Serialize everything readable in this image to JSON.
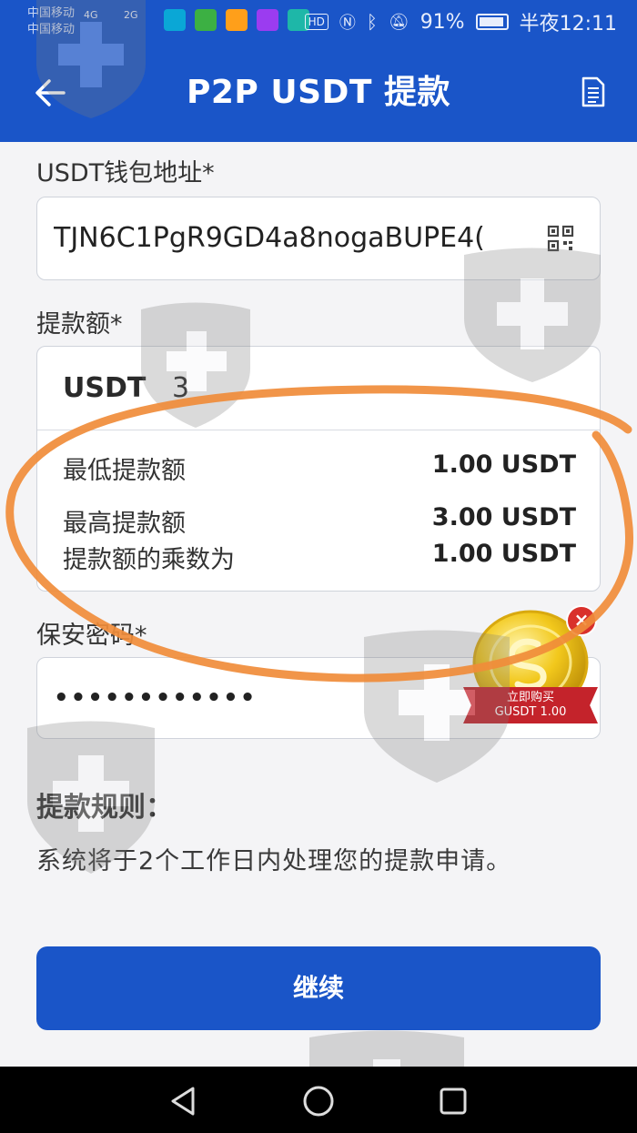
{
  "status_bar": {
    "carrier_1": "中国移动",
    "carrier_2": "中国移动",
    "signal_1": "4G",
    "signal_2": "2G",
    "hd": "HD",
    "battery": "91%",
    "time": "半夜12:11"
  },
  "header": {
    "title": "P2P USDT 提款",
    "back_icon": "arrow-left-icon",
    "doc_icon": "document-icon",
    "bg_color": "#1a55c8"
  },
  "form": {
    "address_label": "USDT钱包地址*",
    "address_value": "TJN6C1PgR9GD4a8nogaBUPE4(",
    "qr_icon": "qr-scan-icon",
    "amount_label": "提款额*",
    "currency": "USDT",
    "amount_value": "3",
    "min_label": "最低提款额",
    "min_value": "1.00 USDT",
    "max_label": "最高提款额",
    "max_value": "3.00 USDT",
    "multiple_label": "提款额的乘数为",
    "multiple_value": "1.00 USDT",
    "password_label": "保安密码*",
    "password_value": "••••••••••••"
  },
  "rules": {
    "title": "提款规则：",
    "text": "系统将于2个工作日内处理您的提款申请。"
  },
  "actions": {
    "continue_label": "继续"
  },
  "promo": {
    "line1": "立即购买",
    "line2": "GUSDT 1.00"
  },
  "nav": {
    "back_icon": "nav-back-icon",
    "home_icon": "nav-home-icon",
    "recents_icon": "nav-recents-icon"
  }
}
